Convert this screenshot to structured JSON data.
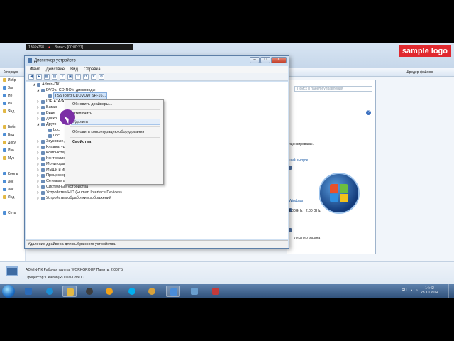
{
  "recorder": {
    "resolution": "1366x768",
    "record_label": "Запись [00:00:27]"
  },
  "watermark": "sample logo",
  "explorer": {
    "cmd_left": "Упорядо",
    "cmd_right": "Шредер файлов",
    "nav_items": [
      "Избр",
      "Заг",
      "Не",
      "Ра",
      "Янд",
      "",
      "Библ",
      "Вид",
      "Доку",
      "Изо",
      "Муз",
      "",
      "Компь",
      "Лок",
      "Лок",
      "Янд",
      "",
      "Сеть"
    ],
    "details": {
      "line1": "ADMIN-ПК   Рабочая группа:  WORKGROUP              Память:  2,00 ГБ",
      "line2": "Процессор:  Celeron(R) Dual-Core C..."
    }
  },
  "system_window": {
    "search_placeholder": "Поиск в панели управления",
    "edition_text": "ицензированы.",
    "update_link": "ший выпуск",
    "windows_label": "Windows",
    "cpu_freq_1": "2.00GHz",
    "cpu_freq_2": "2.00 GHz",
    "screen_text": "ля этого экрана",
    "help_icon": "?"
  },
  "device_manager": {
    "title": "Диспетчер устройств",
    "menu": [
      "Файл",
      "Действие",
      "Вид",
      "Справка"
    ],
    "tree": {
      "root": "Admin-ПК",
      "dvd": "DVD и CD-ROM дисководы",
      "dvd_device": "TSSTcorp CDDVDW SH-16...",
      "ide": "IDE ATA/ATAPI контроллеры",
      "battery": "Батар",
      "video": "Виде",
      "disk": "Диско",
      "other": "Друго",
      "other_sub1": "Loc",
      "other_sub2": "Loc",
      "items": [
        "Звуковые, видео и игровые устройства",
        "Клавиатуры",
        "Компьютер",
        "Контроллеры USB",
        "Мониторы",
        "Мыши и иные указывающие устройства",
        "Процессоры",
        "Сетевые адаптеры",
        "Системные устройства",
        "Устройства HID (Human Interface Devices)",
        "Устройства обработки изображений"
      ]
    },
    "status": "Удаление драйвера для выбранного устройства."
  },
  "context_menu": {
    "update_driver": "Обновить драйверы...",
    "disable": "Отключить",
    "uninstall": "Удалить",
    "scan": "Обновить конфигурацию оборудования",
    "properties": "Свойства"
  },
  "taskbar": {
    "language": "RU",
    "time": "14:42",
    "date": "28.10.2014"
  },
  "colors": {
    "accent": "#2f4f78",
    "watermark": "#e0282f",
    "cursor": "#7b2fa6"
  }
}
